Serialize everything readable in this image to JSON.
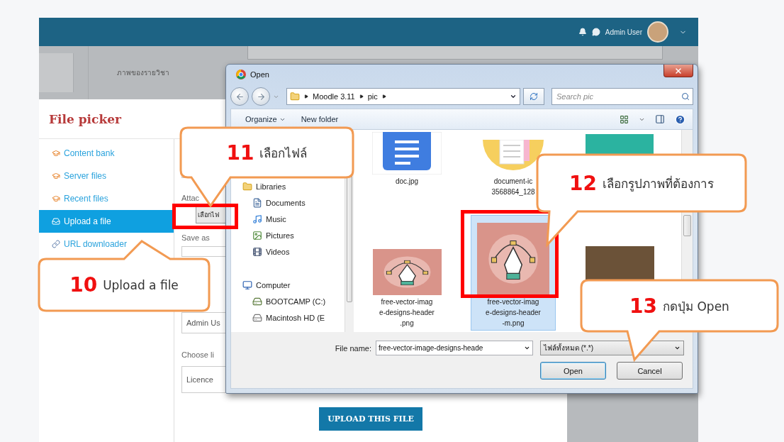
{
  "topbar": {
    "user_name": "Admin User"
  },
  "course_header": {
    "label": "ภาพของรายวิชา"
  },
  "file_picker": {
    "title": "File picker",
    "repositories": [
      {
        "label": "Content bank",
        "kind": "repository",
        "selected": false
      },
      {
        "label": "Server files",
        "kind": "repository",
        "selected": false
      },
      {
        "label": "Recent files",
        "kind": "repository",
        "selected": false
      },
      {
        "label": "Upload a file",
        "kind": "upload",
        "selected": true
      },
      {
        "label": "URL downloader",
        "kind": "link",
        "selected": false
      }
    ],
    "form": {
      "attachment_label": "Attac",
      "choose_button": "เลือกไฟ",
      "save_as_label": "Save as",
      "author_value": "Admin Us",
      "licence_label": "Choose li",
      "licence_value": "Licence",
      "upload_button": "UPLOAD THIS FILE"
    }
  },
  "open_dialog": {
    "title": "Open",
    "path": [
      "Moodle 3.11",
      "pic"
    ],
    "search": {
      "placeholder": "Search pic"
    },
    "toolbar": {
      "organize": "Organize",
      "new_folder": "New folder"
    },
    "navigation": [
      {
        "label": "Libraries",
        "kind": "library",
        "children": [
          {
            "label": "Documents",
            "kind": "documents"
          },
          {
            "label": "Music",
            "kind": "music"
          },
          {
            "label": "Pictures",
            "kind": "pictures"
          },
          {
            "label": "Videos",
            "kind": "videos"
          }
        ]
      },
      {
        "label": "Computer",
        "kind": "computer",
        "children": [
          {
            "label": "BOOTCAMP (C:)",
            "kind": "system-drive"
          },
          {
            "label": "Macintosh HD (E",
            "kind": "drive"
          }
        ]
      }
    ],
    "files": [
      {
        "kind": "doc",
        "label_lines": [
          "doc.jpg"
        ],
        "selected": false
      },
      {
        "kind": "paper",
        "label_lines": [
          "document-ic",
          "3568864_128"
        ],
        "selected": false
      },
      {
        "kind": "banner",
        "selected": false
      },
      {
        "kind": "pen",
        "label_lines": [
          "free-vector-imag",
          "e-designs-header",
          ".png"
        ],
        "selected": false
      },
      {
        "kind": "pen",
        "label_lines": [
          "free-vector-imag",
          "e-designs-header",
          "-m.png"
        ],
        "selected": true
      },
      {
        "kind": "photo",
        "selected": false
      }
    ],
    "file_name_label": "File name:",
    "file_name": "free-vector-image-designs-heade",
    "file_type": "ไฟล์ทั้งหมด (*.*)",
    "buttons": [
      "Open",
      "Cancel"
    ]
  },
  "callouts": [
    {
      "number": "10",
      "text": "Upload a file"
    },
    {
      "number": "11",
      "text": "เลือกไฟล์"
    },
    {
      "number": "12",
      "text": "เลือกรูปภาพที่ต้องการ"
    },
    {
      "number": "13",
      "text": "กดปุ่ม Open"
    }
  ]
}
